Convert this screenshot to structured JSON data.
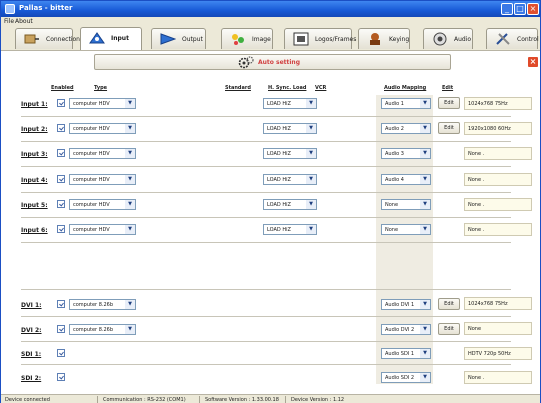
{
  "window": {
    "title": "Pallas - bitter"
  },
  "menu": {
    "file": "File",
    "about": "About"
  },
  "tabs": [
    {
      "label": "Connection",
      "icon": "connection-icon"
    },
    {
      "label": "Input",
      "icon": "input-icon"
    },
    {
      "label": "Output",
      "icon": "output-icon"
    },
    {
      "label": "Image",
      "icon": "image-icon"
    },
    {
      "label": "Logos/Frames",
      "icon": "logos-frames-icon"
    },
    {
      "label": "Keying",
      "icon": "keying-icon"
    },
    {
      "label": "Audio",
      "icon": "audio-icon"
    },
    {
      "label": "Control",
      "icon": "control-icon"
    }
  ],
  "auto_setting": {
    "label": "Auto setting",
    "icon": "gears-icon"
  },
  "columns": {
    "enabled": "Enabled",
    "type": "Type",
    "standard": "Standard",
    "sync_load": "H. Sync. Load",
    "vcr": "VCR",
    "audio_mapping": "Audio Mapping",
    "edit": "Edit"
  },
  "rows": [
    {
      "label": "Input 1:",
      "type": "computer HDV",
      "load": "LOAD HiZ",
      "audio": "Audio 1",
      "edit": "Edit",
      "info": "1024x768 75Hz"
    },
    {
      "label": "Input 2:",
      "type": "computer HDV",
      "load": "LOAD HiZ",
      "audio": "Audio 2",
      "edit": "Edit",
      "info": "1920x1080 60Hz"
    },
    {
      "label": "Input 3:",
      "type": "computer HDV",
      "load": "LOAD HiZ",
      "audio": "Audio 3",
      "edit": "",
      "info": "None ."
    },
    {
      "label": "Input 4:",
      "type": "computer HDV",
      "load": "LOAD HiZ",
      "audio": "Audio 4",
      "edit": "",
      "info": "None ."
    },
    {
      "label": "Input 5:",
      "type": "computer HDV",
      "load": "LOAD HiZ",
      "audio": "None",
      "edit": "",
      "info": "None ."
    },
    {
      "label": "Input 6:",
      "type": "computer HDV",
      "load": "LOAD HiZ",
      "audio": "None",
      "edit": "",
      "info": "None ."
    },
    {
      "label": "DVI 1:",
      "type": "computer 8.26b",
      "load": "",
      "audio": "Audio DVI 1",
      "edit": "Edit",
      "info": "1024x768 75Hz"
    },
    {
      "label": "DVI 2:",
      "type": "computer 8.26b",
      "load": "",
      "audio": "Audio DVI 2",
      "edit": "Edit",
      "info": "None"
    },
    {
      "label": "SDI 1:",
      "type": "",
      "load": "",
      "audio": "Audio SDI 1",
      "edit": "",
      "info": "HDTV 720p 50Hz"
    },
    {
      "label": "SDI 2:",
      "type": "",
      "load": "",
      "audio": "Audio SDI 2",
      "edit": "",
      "info": "None ."
    }
  ],
  "status": {
    "device": "Device connected",
    "communication": "Communication : RS-232 (COM1)",
    "software": "Software Version : 1.33.00.18",
    "device_version": "Device Version : 1.12"
  }
}
